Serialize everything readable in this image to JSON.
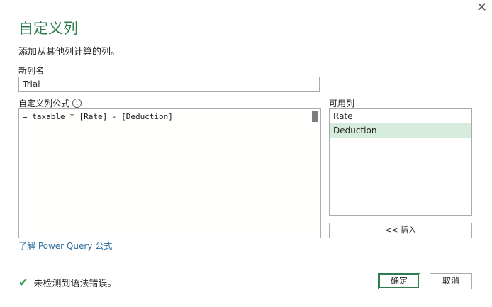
{
  "dialog": {
    "close_glyph": "✕",
    "title": "自定义列",
    "subtitle": "添加从其他列计算的列。"
  },
  "new_column": {
    "label": "新列名",
    "value": "Trial"
  },
  "formula": {
    "label": "自定义列公式",
    "info_icon": "ⓘ",
    "text": "= taxable * [Rate] - [Deduction]"
  },
  "available_columns": {
    "label": "可用列",
    "items": [
      {
        "label": "Rate",
        "selected": false
      },
      {
        "label": "Deduction",
        "selected": true
      }
    ],
    "insert_label": "<< 插入"
  },
  "learn_link": "了解 Power Query 公式",
  "status": {
    "icon": "checkmark-icon",
    "text": "未检测到语法错误。",
    "color": "#2e9b4d"
  },
  "buttons": {
    "ok": "确定",
    "cancel": "取消"
  },
  "colors": {
    "accent": "#2e7d4f",
    "selection": "#d5ecdd",
    "link": "#2e6e9e"
  }
}
